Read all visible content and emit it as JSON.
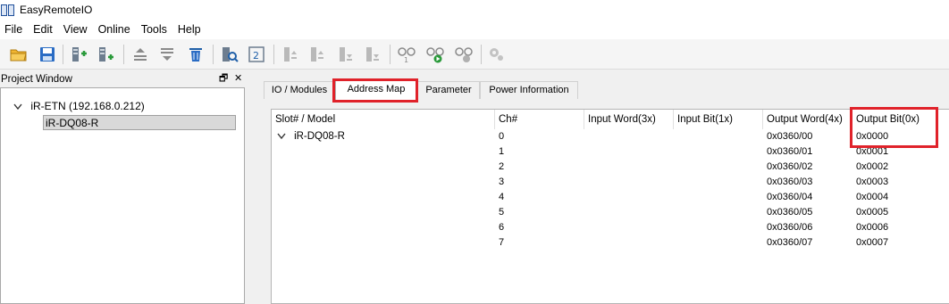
{
  "window": {
    "title": "EasyRemoteIO",
    "icon": "app-grid-icon"
  },
  "menu": [
    "File",
    "Edit",
    "View",
    "Online",
    "Tools",
    "Help"
  ],
  "toolbar": {
    "buttons": [
      {
        "name": "open-folder-icon"
      },
      {
        "name": "save-disk-icon"
      },
      {
        "name": "add-module-icon"
      },
      {
        "name": "add-module-alt-icon"
      },
      {
        "name": "move-up-icon"
      },
      {
        "name": "move-down-icon"
      },
      {
        "name": "delete-trash-icon"
      },
      {
        "name": "search-device-icon"
      },
      {
        "name": "io-address-icon"
      },
      {
        "name": "io-upload-icon"
      },
      {
        "name": "io-download-icon"
      },
      {
        "name": "io-read-icon"
      },
      {
        "name": "io-write-icon"
      },
      {
        "name": "connect-icon"
      },
      {
        "name": "connect-go-icon"
      },
      {
        "name": "disconnect-icon"
      },
      {
        "name": "settings-gear-icon"
      }
    ]
  },
  "project_window": {
    "title": "Project Window",
    "restore_glyph": "🗗",
    "close_glyph": "✕",
    "tree": {
      "root_label": "iR-ETN (192.168.0.212)",
      "child_label": "iR-DQ08-R"
    }
  },
  "tabs": [
    "IO / Modules",
    "Address Map",
    "Parameter",
    "Power Information"
  ],
  "active_tab": "Address Map",
  "address_map": {
    "columns": [
      "Slot# / Model",
      "Ch#",
      "Input Word(3x)",
      "Input Bit(1x)",
      "Output Word(4x)",
      "Output Bit(0x)"
    ],
    "group_label": "iR-DQ08-R",
    "rows": [
      {
        "ch": "0",
        "output_word": "0x0360/00",
        "output_bit": "0x0000"
      },
      {
        "ch": "1",
        "output_word": "0x0360/01",
        "output_bit": "0x0001"
      },
      {
        "ch": "2",
        "output_word": "0x0360/02",
        "output_bit": "0x0002"
      },
      {
        "ch": "3",
        "output_word": "0x0360/03",
        "output_bit": "0x0003"
      },
      {
        "ch": "4",
        "output_word": "0x0360/04",
        "output_bit": "0x0004"
      },
      {
        "ch": "5",
        "output_word": "0x0360/05",
        "output_bit": "0x0005"
      },
      {
        "ch": "6",
        "output_word": "0x0360/06",
        "output_bit": "0x0006"
      },
      {
        "ch": "7",
        "output_word": "0x0360/07",
        "output_bit": "0x0007"
      }
    ]
  },
  "colors": {
    "highlight": "#e0222a",
    "icon_blue": "#1f5fa8",
    "icon_disabled": "#a8a8a8"
  }
}
